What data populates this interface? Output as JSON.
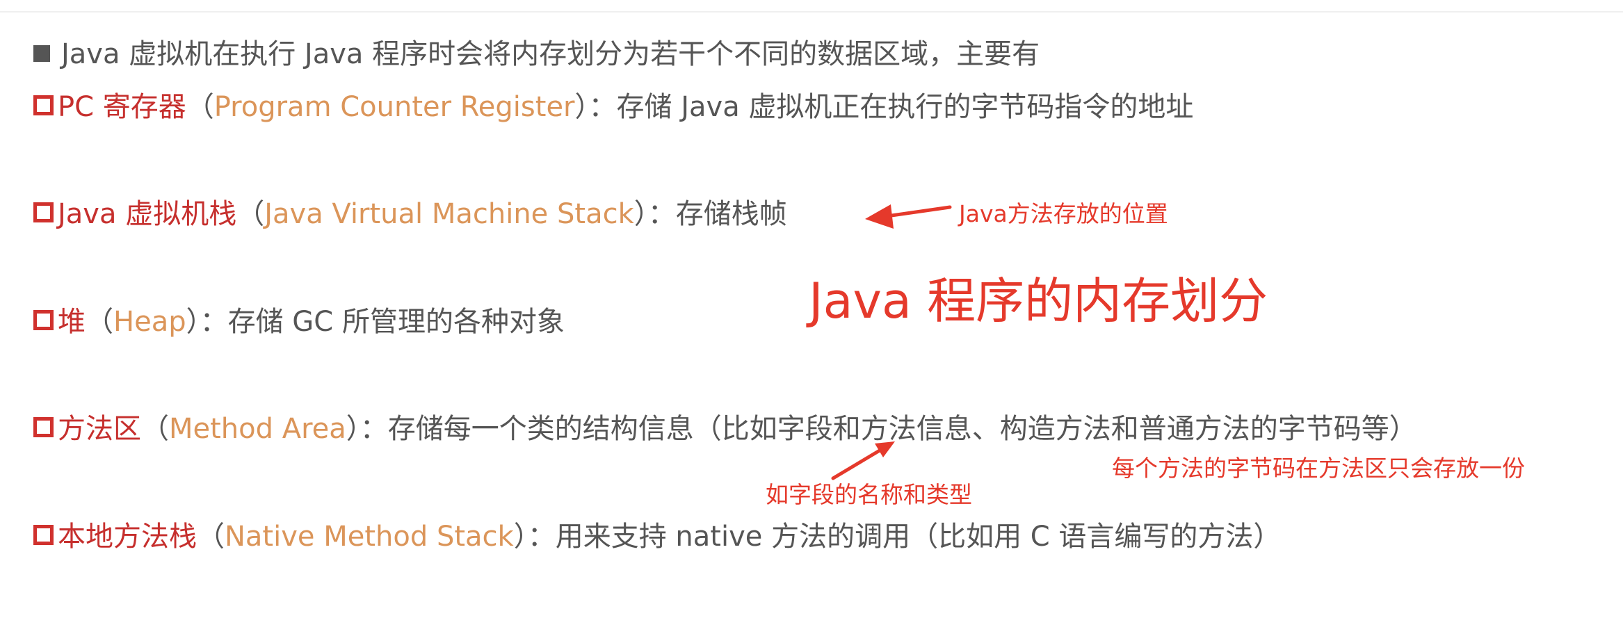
{
  "intro": "Java 虚拟机在执行 Java 程序时会将内存划分为若干个不同的数据区域，主要有",
  "items": [
    {
      "term": "PC 寄存器",
      "open": "（",
      "english": "Program Counter Register",
      "close": "）：",
      "desc": "存储 Java 虚拟机正在执行的字节码指令的地址"
    },
    {
      "term": "Java 虚拟机栈",
      "open": "（",
      "english": "Java Virtual Machine Stack",
      "close": "）：",
      "desc": "存储栈帧"
    },
    {
      "term": "堆",
      "open": "（",
      "english": "Heap",
      "close": "）：",
      "desc": "存储 GC 所管理的各种对象"
    },
    {
      "term": "方法区",
      "open": "（",
      "english": "Method Area",
      "close": "）：",
      "desc": "存储每一个类的结构信息（比如字段和方法信息、构造方法和普通方法的字节码等）"
    },
    {
      "term": "本地方法栈",
      "open": "（",
      "english": "Native Method Stack",
      "close": "）：",
      "desc": "用来支持 native 方法的调用（比如用 C 语言编写的方法）"
    }
  ],
  "annotations": {
    "stack_note": "Java方法存放的位置",
    "title": "Java 程序的内存划分",
    "field_note": "如字段的名称和类型",
    "bytecode_note": "每个方法的字节码在方法区只会存放一份"
  },
  "colors": {
    "body_text": "#555555",
    "term": "#c62f2d",
    "english": "#db9559",
    "annotation": "#e5392b"
  }
}
